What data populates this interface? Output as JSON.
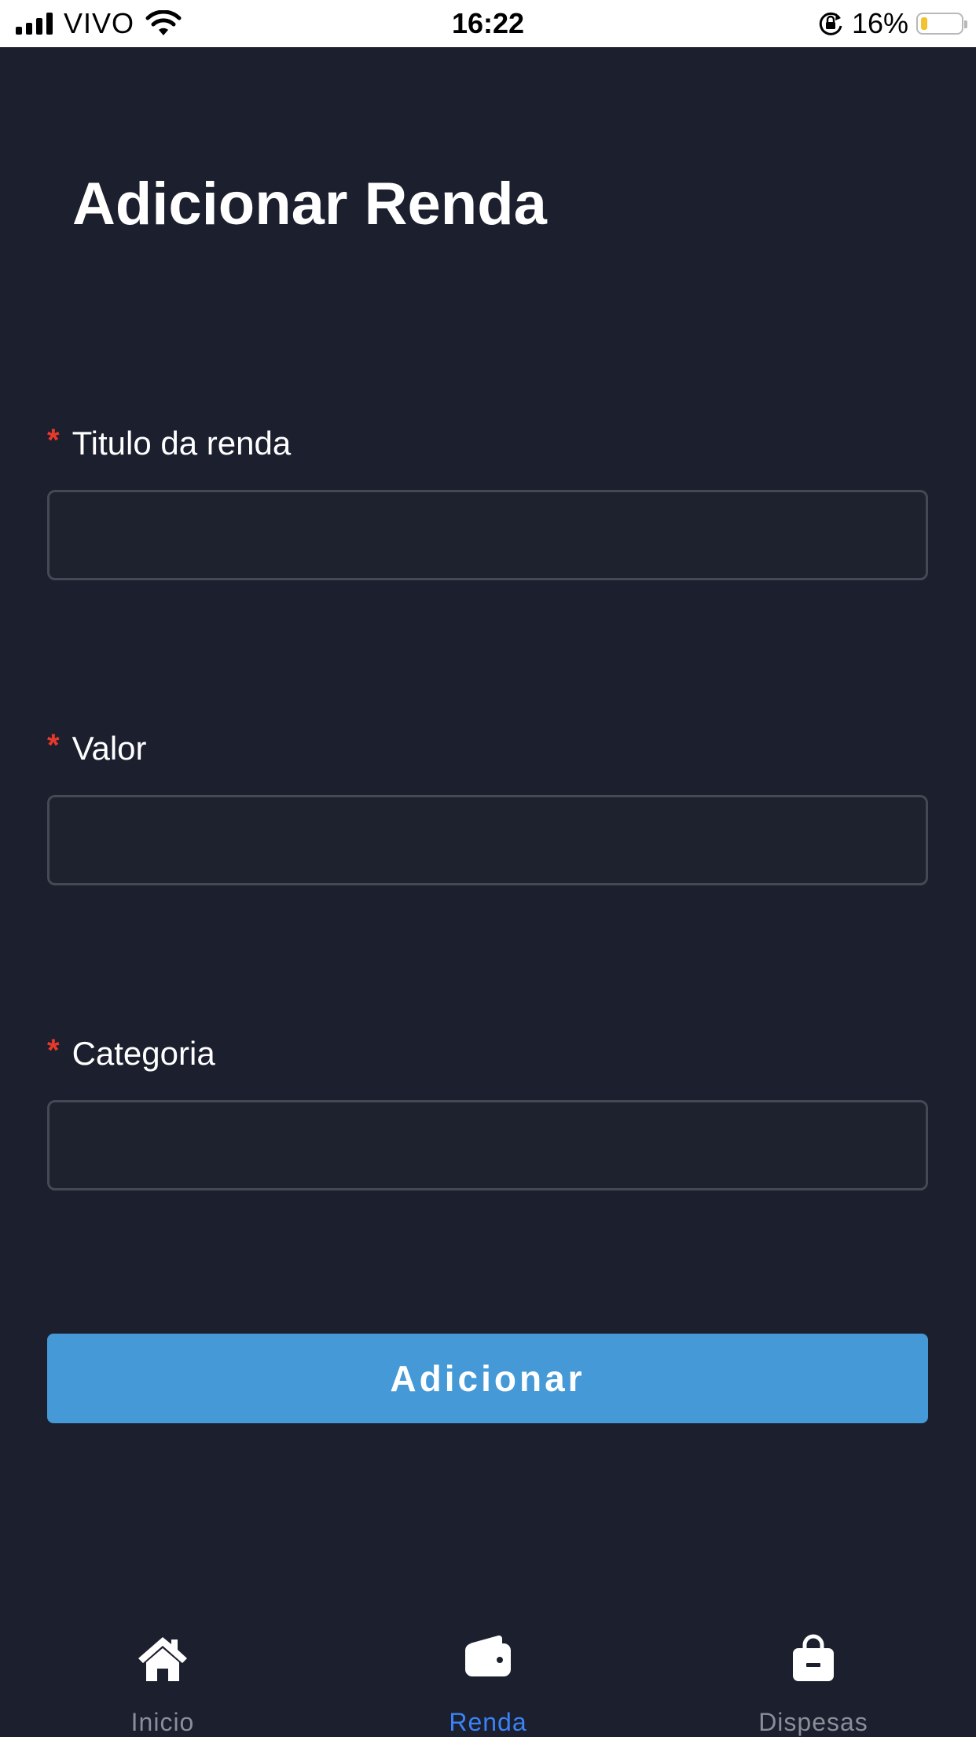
{
  "status_bar": {
    "carrier": "VIVO",
    "time": "16:22",
    "battery": "16%",
    "battery_level": 0.16,
    "battery_color": "#f2c230"
  },
  "page": {
    "title": "Adicionar Renda"
  },
  "form": {
    "required_marker": "*",
    "fields": [
      {
        "label": "Titulo da renda",
        "value": "",
        "placeholder": ""
      },
      {
        "label": "Valor",
        "value": "",
        "placeholder": ""
      },
      {
        "label": "Categoria",
        "value": "",
        "placeholder": ""
      }
    ],
    "submit_label": "Adicionar",
    "submit_color": "#4499d6",
    "required_color": "#e5392a"
  },
  "tab_bar": {
    "tabs": [
      {
        "label": "Inicio",
        "icon": "home-icon",
        "active": false
      },
      {
        "label": "Renda",
        "icon": "wallet-icon",
        "active": true
      },
      {
        "label": "Dispesas",
        "icon": "shopping-bag-icon",
        "active": false
      }
    ],
    "active_color": "#3b82f6",
    "inactive_color": "#8a8e97"
  }
}
